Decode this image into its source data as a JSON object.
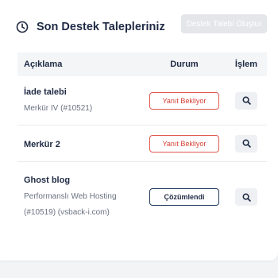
{
  "header": {
    "title": "Son Destek Talepleriniz",
    "create_button": "Destek Talebi Oluştur",
    "icon": "clock-icon"
  },
  "table": {
    "columns": [
      "Açıklama",
      "Durum",
      "İşlem"
    ],
    "rows": [
      {
        "title": "İade talebi",
        "sub": [
          "Merkür IV (#10521)"
        ],
        "status": "Yanıt Bekliyor",
        "status_kind": "pending"
      },
      {
        "title": "Merkür 2",
        "sub": [],
        "status": "Yanıt Bekliyor",
        "status_kind": "pending"
      },
      {
        "title": "Ghost blog",
        "sub": [
          "Performanslı Web Hosting",
          "(#10519) (vsback-i.com)"
        ],
        "status": "Çözümlendi",
        "status_kind": "solved"
      }
    ]
  },
  "colors": {
    "pending": "#d43f33",
    "solved": "#1f3a5a",
    "text": "#1f2a44"
  }
}
